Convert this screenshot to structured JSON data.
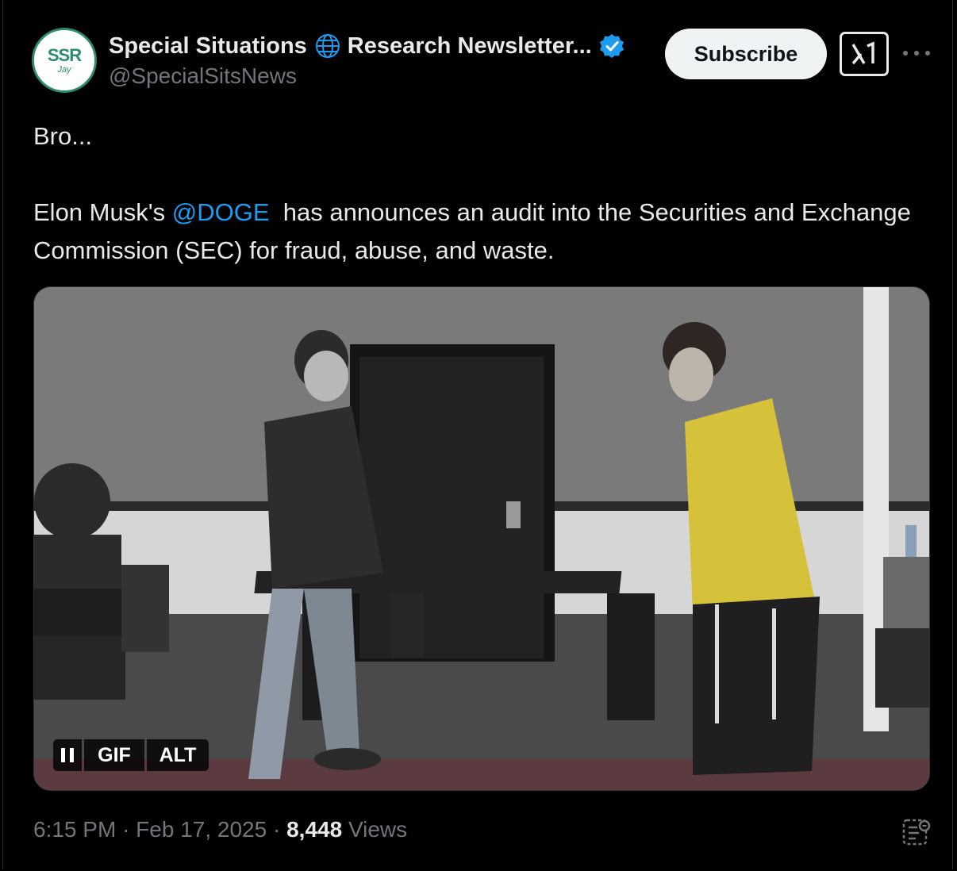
{
  "author": {
    "display_name": "Special Situations",
    "display_name_suffix": "Research Newsletter...",
    "handle": "@SpecialSitsNews",
    "avatar_text": "SSR",
    "avatar_subtext": "Jay",
    "avatar_color": "#2e8b6e",
    "verified": true,
    "verified_color": "#1d9bf0"
  },
  "actions": {
    "subscribe_label": "Subscribe",
    "grok_icon": "grok-icon",
    "more_icon": "more-horizontal-icon"
  },
  "tweet": {
    "line1": "Bro...",
    "line2_prefix": "Elon Musk's ",
    "mention": "@DOGE",
    "line2_suffix": "  has announces an audit into the Securities and Exchange Commission (SEC) for fraud, abuse, and waste.",
    "mention_color": "#1d9bf0"
  },
  "media": {
    "type": "gif",
    "gif_label": "GIF",
    "alt_label": "ALT",
    "pause_icon": "pause-icon"
  },
  "meta": {
    "time": "6:15 PM",
    "separator": "·",
    "date": "Feb 17, 2025",
    "views_count": "8,448",
    "views_label": "Views"
  }
}
